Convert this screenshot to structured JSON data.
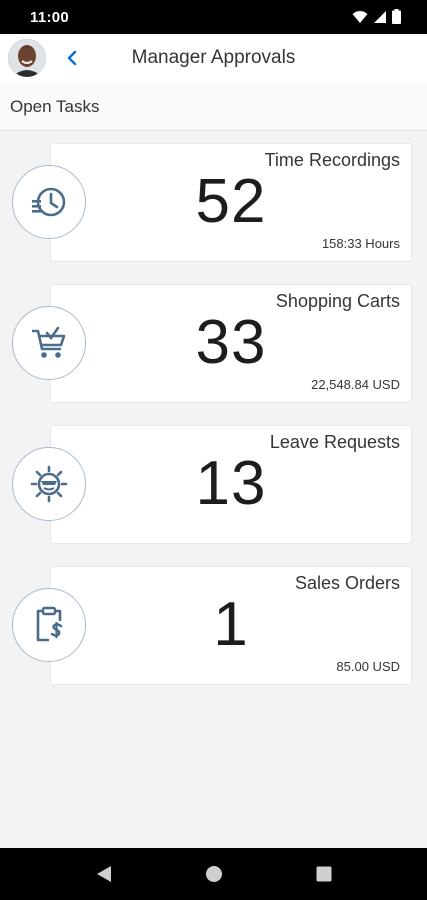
{
  "status_bar": {
    "time": "11:00",
    "icons": [
      "wifi-icon",
      "cellular-signal-icon",
      "battery-icon"
    ]
  },
  "header": {
    "title": "Manager Approvals",
    "back_icon": "chevron-left-icon",
    "avatar": "user-avatar"
  },
  "section": {
    "label": "Open Tasks"
  },
  "tiles": [
    {
      "title": "Time Recordings",
      "count": "52",
      "subtitle": "158:33 Hours",
      "icon": "history-clock-icon"
    },
    {
      "title": "Shopping Carts",
      "count": "33",
      "subtitle": "22,548.84 USD",
      "icon": "shopping-cart-icon"
    },
    {
      "title": "Leave Requests",
      "count": "13",
      "subtitle": "",
      "icon": "sun-vacation-icon"
    },
    {
      "title": "Sales Orders",
      "count": "1",
      "subtitle": "85.00 USD",
      "icon": "clipboard-dollar-icon"
    }
  ],
  "nav_bar": {
    "icons": [
      "back-triangle-icon",
      "home-circle-icon",
      "recents-square-icon"
    ]
  },
  "colors": {
    "accent": "#0a6ed1",
    "icon_stroke": "#4a6d8c",
    "background": "#f2f3f5"
  }
}
